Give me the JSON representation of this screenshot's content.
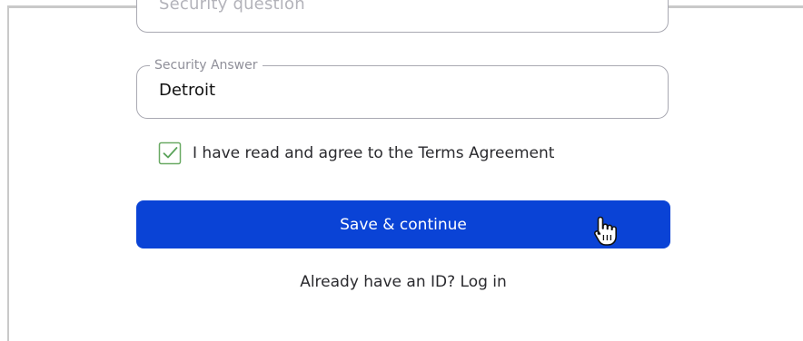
{
  "form": {
    "security_question": {
      "placeholder": "Security question"
    },
    "security_answer": {
      "label": "Security Answer",
      "value": "Detroit"
    },
    "terms": {
      "checked": true,
      "label": "I have read and agree to the Terms Agreement"
    },
    "save_button_label": "Save & continue",
    "login_link_text": "Already have an ID? Log in"
  },
  "colors": {
    "primary_button": "#0a43d6",
    "checkbox_check": "#4caf50",
    "field_border": "#a9a9b2"
  },
  "icons": {
    "checkbox": "checkbox-checked-icon",
    "cursor": "hand-pointer-icon"
  }
}
